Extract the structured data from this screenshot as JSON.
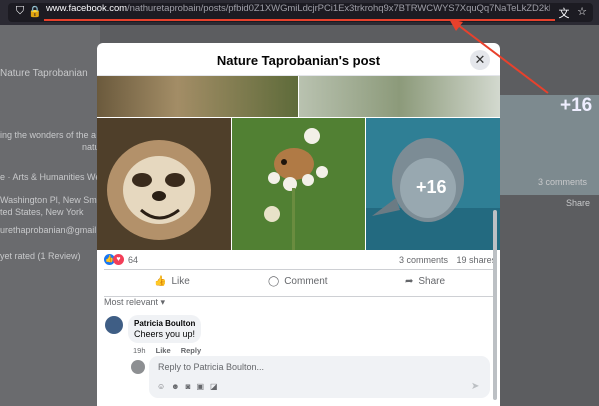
{
  "browser": {
    "url_host": "www.facebook.com",
    "url_path": "/nathuretaprobain/posts/pfbid0Z1XWGmiLdcjrPCi1Ex3trkrohq9x7BTRWCWYS7XquQq7NaTeLkZD2kBoPQBswpR2l?comm"
  },
  "background": {
    "page_name": "Nature Taprobanian",
    "about_text": "ing the wonders of the a",
    "about_text2": "natu",
    "category": "e · Arts & Humanities We",
    "address1": "Washington Pl, New Smith",
    "address2": "ted States, New York",
    "email": "urethaprobanian@gmail.c",
    "rating": "yet rated (1 Review)",
    "right_plus": "+16",
    "right_comments": "3 comments",
    "right_share": "Share"
  },
  "modal": {
    "title": "Nature Taprobanian's post",
    "more_photos": "+16",
    "reaction_count": "64",
    "comments": "3 comments",
    "shares": "19 shares",
    "like": "Like",
    "comment": "Comment",
    "share": "Share",
    "sort": "Most relevant"
  },
  "comment": {
    "author": "Patricia Boulton",
    "text": "Cheers you up!",
    "time": "19h",
    "like": "Like",
    "reply": "Reply"
  },
  "reply_box": {
    "placeholder": "Reply to Patricia Boulton..."
  },
  "colors": {
    "annotation": "#e8412c",
    "like_blue": "#1877f2",
    "love_red": "#f33e58"
  }
}
